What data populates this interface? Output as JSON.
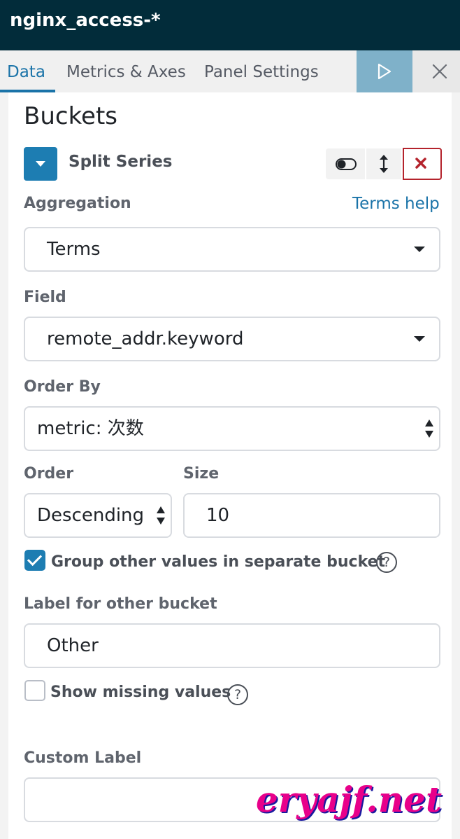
{
  "header": {
    "title": "nginx_access-*"
  },
  "tabs": [
    {
      "label": "Data",
      "active": true
    },
    {
      "label": "Metrics & Axes",
      "active": false
    },
    {
      "label": "Panel Settings",
      "active": false
    }
  ],
  "icons": {
    "play": "play-icon",
    "close": "close-icon",
    "toggle": "toggle-icon",
    "move": "move-vertical-icon",
    "remove": "remove-icon",
    "help": "help-icon"
  },
  "buckets": {
    "heading": "Buckets",
    "split_title": "Split Series"
  },
  "aggregation": {
    "label": "Aggregation",
    "help_link": "Terms help",
    "value": "Terms"
  },
  "field": {
    "label": "Field",
    "value": "remote_addr.keyword"
  },
  "order_by": {
    "label": "Order By",
    "value": "metric: 次数"
  },
  "order": {
    "label": "Order",
    "value": "Descending"
  },
  "size": {
    "label": "Size",
    "value": "10"
  },
  "group_other": {
    "label": "Group other values in separate bucket",
    "checked": true
  },
  "other_label": {
    "label": "Label for other bucket",
    "value": "Other"
  },
  "show_missing": {
    "label": "Show missing values",
    "checked": false
  },
  "custom_label": {
    "label": "Custom Label",
    "value": ""
  },
  "watermark": {
    "text": "eryajf.net"
  },
  "colors": {
    "header_bg": "#022c3a",
    "accent": "#1a73a8",
    "button_blue": "#1d7db2",
    "play_bg": "#7fb1c9",
    "danger": "#b4232c",
    "watermark": "#e8008a"
  }
}
